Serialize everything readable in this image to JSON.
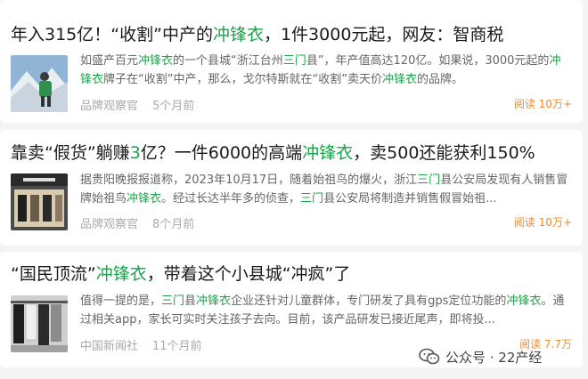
{
  "articles": [
    {
      "title": [
        {
          "t": "年入315亿！“收割”中产的",
          "hl": false
        },
        {
          "t": "冲锋衣",
          "hl": true
        },
        {
          "t": "，1件3000元起，网友：智商税",
          "hl": false
        }
      ],
      "summary": [
        {
          "t": "如盛产百元",
          "hl": false
        },
        {
          "t": "冲锋衣",
          "hl": true
        },
        {
          "t": "的一个县城“浙江台州",
          "hl": false
        },
        {
          "t": "三门",
          "hl": true
        },
        {
          "t": "县”，年产值高达120亿。如果说，3000元起的",
          "hl": false
        },
        {
          "t": "冲锋衣",
          "hl": true
        },
        {
          "t": "牌子在“收割”中产，那么，戈尔特斯就在“收割”卖天价",
          "hl": false
        },
        {
          "t": "冲锋衣",
          "hl": true
        },
        {
          "t": "的品牌。",
          "hl": false
        }
      ],
      "source": "品牌观察官",
      "time": "5个月前",
      "reads": "阅读 10万+",
      "thumb_icon": "mountaineer-photo"
    },
    {
      "title": [
        {
          "t": "靠卖“假货”躺赚",
          "hl": false
        },
        {
          "t": "3",
          "hl": true
        },
        {
          "t": "亿？一件6000的高端",
          "hl": false
        },
        {
          "t": "冲锋衣",
          "hl": true
        },
        {
          "t": "，卖500还能获利150%",
          "hl": false
        }
      ],
      "summary": [
        {
          "t": "据贵阳晚报报道称，2023年10月17日，随着始祖鸟的爆火，浙江",
          "hl": false
        },
        {
          "t": "三门",
          "hl": true
        },
        {
          "t": "县公安局发现有人销售冒牌始祖鸟",
          "hl": false
        },
        {
          "t": "冲锋衣",
          "hl": true
        },
        {
          "t": "。经过长达半年多的侦查，",
          "hl": false
        },
        {
          "t": "三门",
          "hl": true
        },
        {
          "t": "县公安局将制造并销售假冒始祖...",
          "hl": false
        }
      ],
      "source": "品牌观察官",
      "time": "8个月前",
      "reads": "阅读 10万+",
      "thumb_icon": "store-front-photo"
    },
    {
      "title": [
        {
          "t": "“国民顶流”",
          "hl": false
        },
        {
          "t": "冲锋衣",
          "hl": true
        },
        {
          "t": "，带着这个小县城“冲疯”了",
          "hl": false
        }
      ],
      "summary": [
        {
          "t": "值得一提的是，",
          "hl": false
        },
        {
          "t": "三门",
          "hl": true
        },
        {
          "t": "县",
          "hl": false
        },
        {
          "t": "冲锋衣",
          "hl": true
        },
        {
          "t": "企业还针对儿童群体，专门研发了具有gps定位功能的",
          "hl": false
        },
        {
          "t": "冲锋衣",
          "hl": true
        },
        {
          "t": "。通过相关app，家长可实时关注孩子去向。目前，该产品研发已接近尾声，即将投...",
          "hl": false
        }
      ],
      "source": "中国新闻社",
      "time": "11个月前",
      "reads": "阅读 7.7万",
      "thumb_icon": "clothing-rack-photo"
    }
  ],
  "watermark": {
    "text": "公众号 · 22产经",
    "icon": "wechat-icon"
  },
  "colors": {
    "highlight": "#1aa34a",
    "reads": "#f08c2e",
    "meta": "#aaaaaa"
  }
}
